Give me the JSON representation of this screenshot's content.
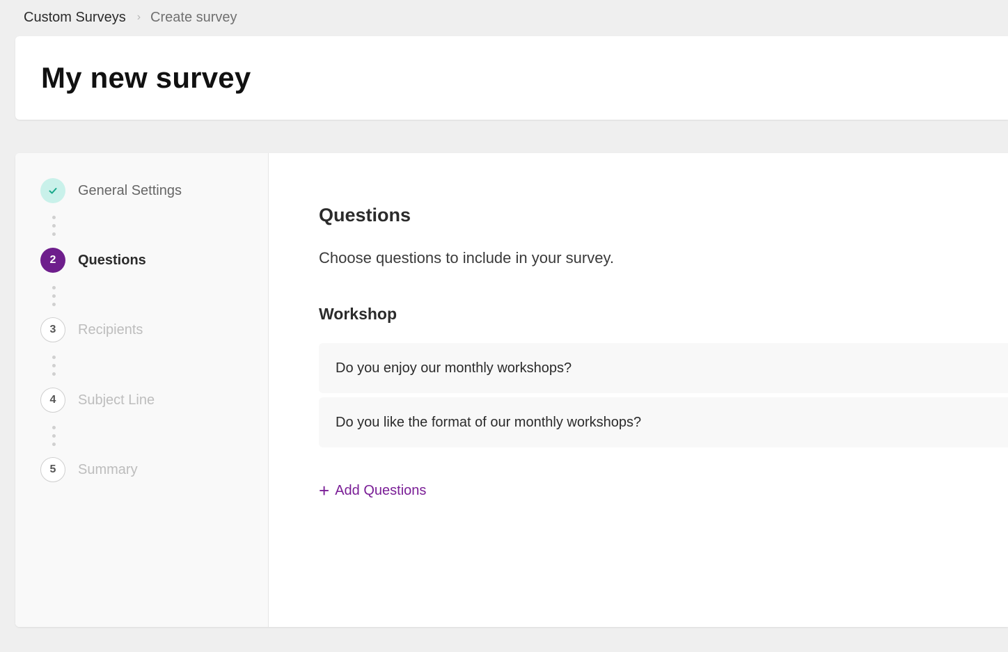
{
  "breadcrumb": {
    "root": "Custom Surveys",
    "separator": "›",
    "current": "Create survey"
  },
  "page": {
    "title": "My new survey"
  },
  "stepper": {
    "steps": [
      {
        "number": "1",
        "label": "General Settings",
        "state": "done",
        "icon": "check-icon"
      },
      {
        "number": "2",
        "label": "Questions",
        "state": "active"
      },
      {
        "number": "3",
        "label": "Recipients",
        "state": "pending"
      },
      {
        "number": "4",
        "label": "Subject Line",
        "state": "pending"
      },
      {
        "number": "5",
        "label": "Summary",
        "state": "pending"
      }
    ]
  },
  "content": {
    "title": "Questions",
    "description": "Choose questions to include in your survey.",
    "group": {
      "title": "Workshop",
      "questions": [
        "Do you enjoy our monthly workshops?",
        "Do you like the format of our monthly workshops?"
      ]
    },
    "add_label": "Add Questions",
    "add_icon": "+"
  },
  "colors": {
    "accent": "#6e1e8c",
    "link": "#7a1e96",
    "done_bg": "#c9f1ea",
    "done_check": "#18a88a"
  }
}
